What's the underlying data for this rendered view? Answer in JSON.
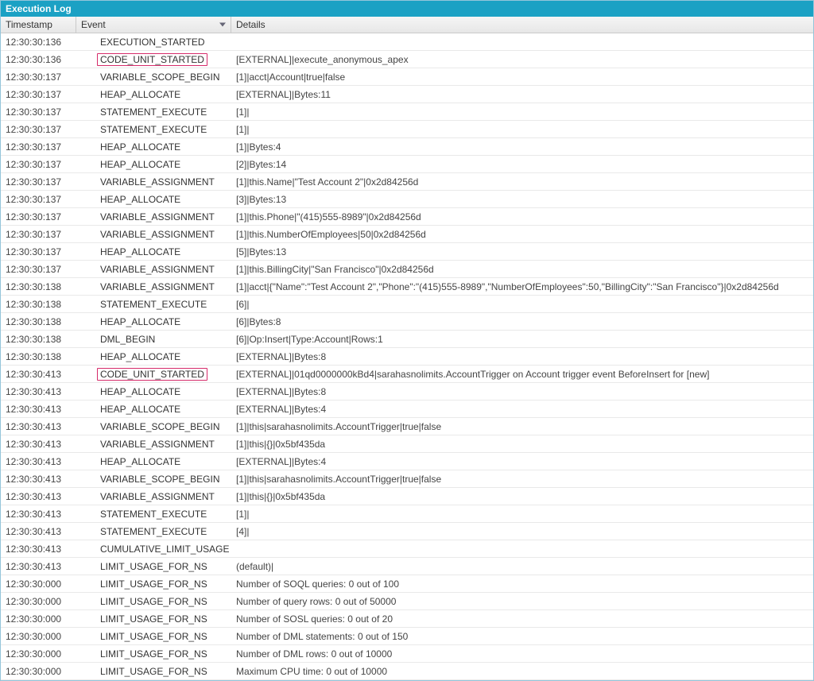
{
  "panel_title": "Execution Log",
  "columns": {
    "timestamp": "Timestamp",
    "event": "Event",
    "details": "Details"
  },
  "rows": [
    {
      "ts": "12:30:30:136",
      "evt": "EXECUTION_STARTED",
      "det": "",
      "hl": false
    },
    {
      "ts": "12:30:30:136",
      "evt": "CODE_UNIT_STARTED",
      "det": "[EXTERNAL]|execute_anonymous_apex",
      "hl": true
    },
    {
      "ts": "12:30:30:137",
      "evt": "VARIABLE_SCOPE_BEGIN",
      "det": "[1]|acct|Account|true|false",
      "hl": false
    },
    {
      "ts": "12:30:30:137",
      "evt": "HEAP_ALLOCATE",
      "det": "[EXTERNAL]|Bytes:11",
      "hl": false
    },
    {
      "ts": "12:30:30:137",
      "evt": "STATEMENT_EXECUTE",
      "det": "[1]|",
      "hl": false
    },
    {
      "ts": "12:30:30:137",
      "evt": "STATEMENT_EXECUTE",
      "det": "[1]|",
      "hl": false
    },
    {
      "ts": "12:30:30:137",
      "evt": "HEAP_ALLOCATE",
      "det": "[1]|Bytes:4",
      "hl": false
    },
    {
      "ts": "12:30:30:137",
      "evt": "HEAP_ALLOCATE",
      "det": "[2]|Bytes:14",
      "hl": false
    },
    {
      "ts": "12:30:30:137",
      "evt": "VARIABLE_ASSIGNMENT",
      "det": "[1]|this.Name|\"Test Account 2\"|0x2d84256d",
      "hl": false
    },
    {
      "ts": "12:30:30:137",
      "evt": "HEAP_ALLOCATE",
      "det": "[3]|Bytes:13",
      "hl": false
    },
    {
      "ts": "12:30:30:137",
      "evt": "VARIABLE_ASSIGNMENT",
      "det": "[1]|this.Phone|\"(415)555-8989\"|0x2d84256d",
      "hl": false
    },
    {
      "ts": "12:30:30:137",
      "evt": "VARIABLE_ASSIGNMENT",
      "det": "[1]|this.NumberOfEmployees|50|0x2d84256d",
      "hl": false
    },
    {
      "ts": "12:30:30:137",
      "evt": "HEAP_ALLOCATE",
      "det": "[5]|Bytes:13",
      "hl": false
    },
    {
      "ts": "12:30:30:137",
      "evt": "VARIABLE_ASSIGNMENT",
      "det": "[1]|this.BillingCity|\"San Francisco\"|0x2d84256d",
      "hl": false
    },
    {
      "ts": "12:30:30:138",
      "evt": "VARIABLE_ASSIGNMENT",
      "det": "[1]|acct|{\"Name\":\"Test Account 2\",\"Phone\":\"(415)555-8989\",\"NumberOfEmployees\":50,\"BillingCity\":\"San Francisco\"}|0x2d84256d",
      "hl": false
    },
    {
      "ts": "12:30:30:138",
      "evt": "STATEMENT_EXECUTE",
      "det": "[6]|",
      "hl": false
    },
    {
      "ts": "12:30:30:138",
      "evt": "HEAP_ALLOCATE",
      "det": "[6]|Bytes:8",
      "hl": false
    },
    {
      "ts": "12:30:30:138",
      "evt": "DML_BEGIN",
      "det": "[6]|Op:Insert|Type:Account|Rows:1",
      "hl": false
    },
    {
      "ts": "12:30:30:138",
      "evt": "HEAP_ALLOCATE",
      "det": "[EXTERNAL]|Bytes:8",
      "hl": false
    },
    {
      "ts": "12:30:30:413",
      "evt": "CODE_UNIT_STARTED",
      "det": "[EXTERNAL]|01qd0000000kBd4|sarahasnolimits.AccountTrigger on Account trigger event BeforeInsert for [new]",
      "hl": true
    },
    {
      "ts": "12:30:30:413",
      "evt": "HEAP_ALLOCATE",
      "det": "[EXTERNAL]|Bytes:8",
      "hl": false
    },
    {
      "ts": "12:30:30:413",
      "evt": "HEAP_ALLOCATE",
      "det": "[EXTERNAL]|Bytes:4",
      "hl": false
    },
    {
      "ts": "12:30:30:413",
      "evt": "VARIABLE_SCOPE_BEGIN",
      "det": "[1]|this|sarahasnolimits.AccountTrigger|true|false",
      "hl": false
    },
    {
      "ts": "12:30:30:413",
      "evt": "VARIABLE_ASSIGNMENT",
      "det": "[1]|this|{}|0x5bf435da",
      "hl": false
    },
    {
      "ts": "12:30:30:413",
      "evt": "HEAP_ALLOCATE",
      "det": "[EXTERNAL]|Bytes:4",
      "hl": false
    },
    {
      "ts": "12:30:30:413",
      "evt": "VARIABLE_SCOPE_BEGIN",
      "det": "[1]|this|sarahasnolimits.AccountTrigger|true|false",
      "hl": false
    },
    {
      "ts": "12:30:30:413",
      "evt": "VARIABLE_ASSIGNMENT",
      "det": "[1]|this|{}|0x5bf435da",
      "hl": false
    },
    {
      "ts": "12:30:30:413",
      "evt": "STATEMENT_EXECUTE",
      "det": "[1]|",
      "hl": false
    },
    {
      "ts": "12:30:30:413",
      "evt": "STATEMENT_EXECUTE",
      "det": "[4]|",
      "hl": false
    },
    {
      "ts": "12:30:30:413",
      "evt": "CUMULATIVE_LIMIT_USAGE",
      "det": "",
      "hl": false
    },
    {
      "ts": "12:30:30:413",
      "evt": "LIMIT_USAGE_FOR_NS",
      "det": "(default)|",
      "hl": false
    },
    {
      "ts": "12:30:30:000",
      "evt": "LIMIT_USAGE_FOR_NS",
      "det": "Number of SOQL queries: 0 out of 100",
      "hl": false
    },
    {
      "ts": "12:30:30:000",
      "evt": "LIMIT_USAGE_FOR_NS",
      "det": "Number of query rows: 0 out of 50000",
      "hl": false
    },
    {
      "ts": "12:30:30:000",
      "evt": "LIMIT_USAGE_FOR_NS",
      "det": "Number of SOSL queries: 0 out of 20",
      "hl": false
    },
    {
      "ts": "12:30:30:000",
      "evt": "LIMIT_USAGE_FOR_NS",
      "det": "Number of DML statements: 0 out of 150",
      "hl": false
    },
    {
      "ts": "12:30:30:000",
      "evt": "LIMIT_USAGE_FOR_NS",
      "det": "Number of DML rows: 0 out of 10000",
      "hl": false
    },
    {
      "ts": "12:30:30:000",
      "evt": "LIMIT_USAGE_FOR_NS",
      "det": "Maximum CPU time: 0 out of 10000",
      "hl": false
    }
  ]
}
